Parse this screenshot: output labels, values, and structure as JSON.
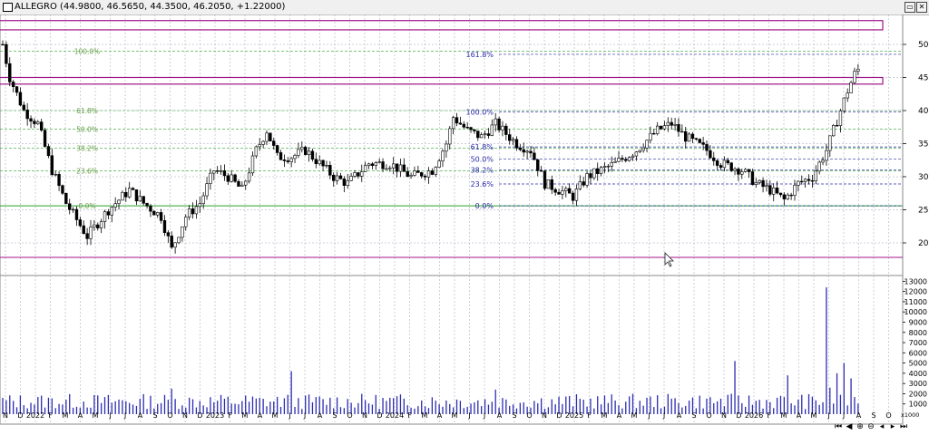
{
  "window": {
    "title": "ALLEGRO (44.9800, 46.5650, 44.3500, 46.2050, +1.22000)",
    "minimize_glyph": "▭",
    "close_glyph": "✕"
  },
  "colors": {
    "candle": "#000000",
    "grid": "#9aa0b4",
    "rect": "#2a2aa8",
    "magenta": "#a0148c",
    "fib_label": "#2a2aa8",
    "fib_old_label": "#6aa04a",
    "green_line": "#2ea52e",
    "volume": "#2c2cb0"
  },
  "nav_icons": [
    "first-icon",
    "prev-icon",
    "zoom-in-icon",
    "zoom-out-icon",
    "prev-page-icon",
    "next-page-icon",
    "last-icon"
  ],
  "chart_data": [
    {
      "type": "candlestick",
      "symbol": "ALLEGRO",
      "x_axis_labels": [
        "N",
        "D",
        "2022",
        "F",
        "M",
        "A",
        "M",
        "J",
        "J",
        "A",
        "S",
        "O",
        "N",
        "D",
        "2023",
        "F",
        "M",
        "A",
        "M",
        "J",
        "J",
        "A",
        "S",
        "O",
        "N",
        "D",
        "2024",
        "F",
        "M",
        "A",
        "M",
        "J",
        "J",
        "A",
        "S",
        "O",
        "N",
        "D",
        "2025",
        "F",
        "M",
        "A",
        "M",
        "J",
        "J",
        "A",
        "S",
        "O",
        "N",
        "D",
        "2026",
        "F",
        "M",
        "A",
        "M",
        "J",
        "J",
        "A",
        "S",
        "O"
      ],
      "ylim": [
        16,
        53
      ],
      "y_ticks": [
        20,
        25,
        30,
        35,
        40,
        45,
        50
      ],
      "price_path": [
        {
          "i": 0,
          "p": 50
        },
        {
          "i": 2,
          "p": 45
        },
        {
          "i": 6,
          "p": 40
        },
        {
          "i": 10,
          "p": 38
        },
        {
          "i": 14,
          "p": 31
        },
        {
          "i": 18,
          "p": 26
        },
        {
          "i": 24,
          "p": 21
        },
        {
          "i": 30,
          "p": 25
        },
        {
          "i": 36,
          "p": 28
        },
        {
          "i": 40,
          "p": 26
        },
        {
          "i": 45,
          "p": 24
        },
        {
          "i": 48,
          "p": 19
        },
        {
          "i": 52,
          "p": 24
        },
        {
          "i": 56,
          "p": 26
        },
        {
          "i": 60,
          "p": 31
        },
        {
          "i": 64,
          "p": 30
        },
        {
          "i": 68,
          "p": 28
        },
        {
          "i": 72,
          "p": 34
        },
        {
          "i": 75,
          "p": 37
        },
        {
          "i": 78,
          "p": 33
        },
        {
          "i": 82,
          "p": 33
        },
        {
          "i": 86,
          "p": 34
        },
        {
          "i": 90,
          "p": 32
        },
        {
          "i": 94,
          "p": 30
        },
        {
          "i": 98,
          "p": 29
        },
        {
          "i": 104,
          "p": 32
        },
        {
          "i": 110,
          "p": 32
        },
        {
          "i": 116,
          "p": 30
        },
        {
          "i": 122,
          "p": 31
        },
        {
          "i": 126,
          "p": 35
        },
        {
          "i": 128,
          "p": 39
        },
        {
          "i": 132,
          "p": 37
        },
        {
          "i": 136,
          "p": 36
        },
        {
          "i": 140,
          "p": 38
        },
        {
          "i": 146,
          "p": 35
        },
        {
          "i": 150,
          "p": 34
        },
        {
          "i": 154,
          "p": 29
        },
        {
          "i": 158,
          "p": 28
        },
        {
          "i": 162,
          "p": 27
        },
        {
          "i": 166,
          "p": 30
        },
        {
          "i": 170,
          "p": 31
        },
        {
          "i": 174,
          "p": 32
        },
        {
          "i": 180,
          "p": 34
        },
        {
          "i": 186,
          "p": 37
        },
        {
          "i": 190,
          "p": 38
        },
        {
          "i": 194,
          "p": 36
        },
        {
          "i": 200,
          "p": 34
        },
        {
          "i": 204,
          "p": 32
        },
        {
          "i": 210,
          "p": 31
        },
        {
          "i": 214,
          "p": 29
        },
        {
          "i": 218,
          "p": 28
        },
        {
          "i": 222,
          "p": 26.5
        },
        {
          "i": 226,
          "p": 29
        },
        {
          "i": 230,
          "p": 30
        },
        {
          "i": 234,
          "p": 34
        },
        {
          "i": 236,
          "p": 37
        },
        {
          "i": 238,
          "p": 40
        },
        {
          "i": 240,
          "p": 43
        },
        {
          "i": 242,
          "p": 45.5
        },
        {
          "i": 243,
          "p": 46.2
        }
      ],
      "fib_levels_blue": [
        {
          "label": "161.8%",
          "price": 48.5
        },
        {
          "label": "100.0%",
          "price": 39.8
        },
        {
          "label": "61.8%",
          "price": 34.5
        },
        {
          "label": "50.0%",
          "price": 32.7
        },
        {
          "label": "38.2%",
          "price": 31.0
        },
        {
          "label": "23.6%",
          "price": 28.9
        },
        {
          "label": "0.0%",
          "price": 25.6
        }
      ],
      "fib_levels_green": [
        {
          "label": "100.0%",
          "price": 49.0
        },
        {
          "label": "61.8%",
          "price": 40.0
        },
        {
          "label": "50.0%",
          "price": 37.2
        },
        {
          "label": "38.2%",
          "price": 34.3
        },
        {
          "label": "23.6%",
          "price": 30.9
        },
        {
          "label": "0.0%",
          "price": 25.6
        }
      ],
      "boxes": [
        {
          "x0": -1,
          "x1": 250,
          "p0": 53.6,
          "p1": 52.2,
          "color": "magenta"
        },
        {
          "x0": -1,
          "x1": 250,
          "p0": 45.0,
          "p1": 44.0,
          "color": "magenta"
        },
        {
          "x0": 46,
          "x1": 56,
          "p0": 45.0,
          "p1": 18.5,
          "color": "blue"
        },
        {
          "x0": 28,
          "x1": 112,
          "p0": 20.0,
          "p1": 19.6,
          "color": "blue"
        },
        {
          "x0": 75,
          "x1": 200,
          "p0": 39.0,
          "p1": 38.6,
          "color": "blue"
        },
        {
          "x0": 68,
          "x1": 240,
          "p0": 35.5,
          "p1": 35.1,
          "color": "blue"
        },
        {
          "x0": 62,
          "x1": 140,
          "p0": 26.4,
          "p1": 26.0,
          "color": "blue"
        },
        {
          "x0": 140,
          "x1": 143,
          "p0": 40.0,
          "p1": 34.0,
          "color": "blue"
        },
        {
          "x0": 161,
          "x1": 165,
          "p0": 30.0,
          "p1": 26.0,
          "color": "blue"
        },
        {
          "x0": 162,
          "x1": 167,
          "p0": 26.3,
          "p1": 25.8,
          "color": "blue"
        },
        {
          "x0": 147,
          "x1": 229,
          "p0": 27.8,
          "p1": 27.4,
          "color": "blue"
        }
      ],
      "horizontal_lines": [
        {
          "price": 17.8,
          "color": "magenta"
        },
        {
          "price": 40.0,
          "color": "blue"
        },
        {
          "price": 35.0,
          "color": "blue"
        },
        {
          "price": 25.6,
          "color": "green_line"
        }
      ]
    },
    {
      "type": "bar",
      "series_label": "volume",
      "ylim": [
        0,
        13500
      ],
      "y_ticks": [
        1000,
        2000,
        3000,
        4000,
        5000,
        6000,
        7000,
        8000,
        9000,
        10000,
        11000,
        12000,
        13000
      ],
      "scale_label": "x1000",
      "spikes": [
        {
          "i": 48,
          "v": 2500
        },
        {
          "i": 82,
          "v": 4200
        },
        {
          "i": 140,
          "v": 2400
        },
        {
          "i": 208,
          "v": 5200
        },
        {
          "i": 223,
          "v": 3800
        },
        {
          "i": 234,
          "v": 12400
        },
        {
          "i": 235,
          "v": 2600
        },
        {
          "i": 237,
          "v": 4000
        },
        {
          "i": 239,
          "v": 5000
        },
        {
          "i": 241,
          "v": 3500
        }
      ]
    }
  ]
}
